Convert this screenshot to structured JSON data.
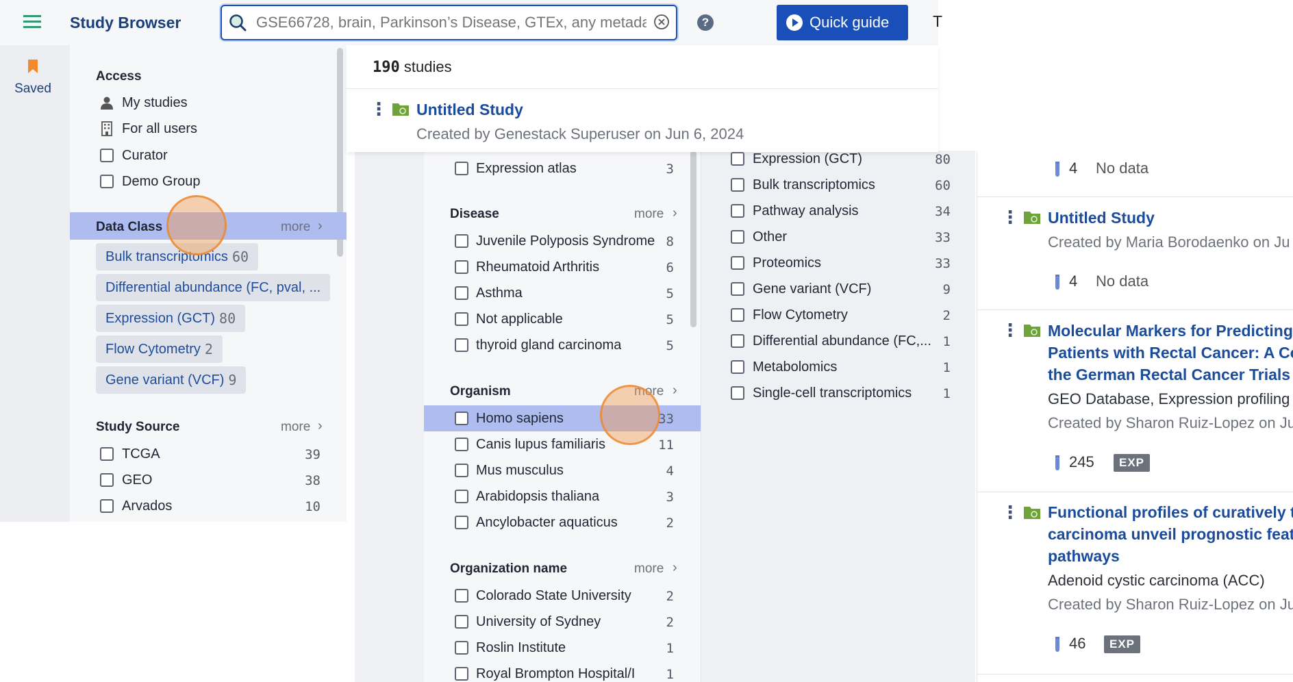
{
  "header": {
    "app_title": "Study Browser",
    "search_placeholder": "GSE66728, brain, Parkinson’s Disease, GTEx, any metadata",
    "quick_guide": "Quick guide",
    "cut_text": "T"
  },
  "rail": {
    "saved_label": "Saved"
  },
  "left_filters": {
    "access": {
      "title": "Access",
      "items": [
        "My studies",
        "For all users",
        "Curator",
        "Demo Group"
      ]
    },
    "data_class": {
      "title": "Data Class",
      "more": "more",
      "chips": [
        {
          "label": "Bulk transcriptomics",
          "count": "60"
        },
        {
          "label": "Differential abundance (FC, pval, ...",
          "count": ""
        },
        {
          "label": "Expression (GCT)",
          "count": "80"
        },
        {
          "label": "Flow Cytometry",
          "count": "2"
        },
        {
          "label": "Gene variant (VCF)",
          "count": "9"
        }
      ]
    },
    "study_source": {
      "title": "Study Source",
      "more": "more",
      "items": [
        {
          "label": "TCGA",
          "count": "39"
        },
        {
          "label": "GEO",
          "count": "38"
        },
        {
          "label": "Arvados",
          "count": "10"
        }
      ]
    }
  },
  "results": {
    "count": "190",
    "count_suffix": "studies",
    "top_study": {
      "title": "Untitled Study",
      "meta": "Created by Genestack Superuser on Jun 6, 2024"
    }
  },
  "mid_filters": {
    "expression_atlas": {
      "label": "Expression atlas",
      "count": "3"
    },
    "disease": {
      "title": "Disease",
      "more": "more",
      "items": [
        {
          "label": "Juvenile Polyposis Syndrome",
          "count": "8"
        },
        {
          "label": "Rheumatoid Arthritis",
          "count": "6"
        },
        {
          "label": "Asthma",
          "count": "5"
        },
        {
          "label": "Not applicable",
          "count": "5"
        },
        {
          "label": "thyroid gland carcinoma",
          "count": "5"
        }
      ]
    },
    "organism": {
      "title": "Organism",
      "more": "more",
      "items": [
        {
          "label": "Homo sapiens",
          "count": "33"
        },
        {
          "label": "Canis lupus familiaris",
          "count": "11"
        },
        {
          "label": "Mus musculus",
          "count": "4"
        },
        {
          "label": "Arabidopsis thaliana",
          "count": "3"
        },
        {
          "label": "Ancylobacter aquaticus",
          "count": "2"
        }
      ]
    },
    "organization": {
      "title": "Organization name",
      "more": "more",
      "items": [
        {
          "label": "Colorado State University",
          "count": "2"
        },
        {
          "label": "University of Sydney",
          "count": "2"
        },
        {
          "label": "Roslin Institute",
          "count": "1"
        },
        {
          "label": "Royal Brompton Hospital/I...",
          "count": "1"
        }
      ]
    }
  },
  "data_class_list": {
    "items": [
      {
        "label": "Expression (GCT)",
        "count": "80"
      },
      {
        "label": "Bulk transcriptomics",
        "count": "60"
      },
      {
        "label": "Pathway analysis",
        "count": "34"
      },
      {
        "label": "Other",
        "count": "33"
      },
      {
        "label": "Proteomics",
        "count": "33"
      },
      {
        "label": "Gene variant (VCF)",
        "count": "9"
      },
      {
        "label": "Flow Cytometry",
        "count": "2"
      },
      {
        "label": "Differential abundance (FC,...",
        "count": "1"
      },
      {
        "label": "Metabolomics",
        "count": "1"
      },
      {
        "label": "Single-cell transcriptomics",
        "count": "1"
      }
    ]
  },
  "study_cards": {
    "card0": {
      "samples": "4",
      "data": "No data"
    },
    "card1": {
      "title": "Untitled Study",
      "meta": "Created by Maria Borodaenko on Ju",
      "samples": "4",
      "data": "No data"
    },
    "card2": {
      "title_lines": [
        "Molecular Markers for Predicting Tr",
        "Patients with Rectal Cancer: A Com",
        "the German Rectal Cancer Trials"
      ],
      "sub": "GEO Database, Expression profiling",
      "meta": "Created by Sharon Ruiz-Lopez on Ju",
      "samples": "245",
      "badge": "EXP"
    },
    "card3": {
      "title_lines": [
        "Functional profiles of curatively tre",
        "carcinoma unveil prognostic feature",
        "pathways"
      ],
      "sub": "Adenoid cystic carcinoma (ACC)",
      "meta": "Created by Sharon Ruiz-Lopez on Ju",
      "samples": "46",
      "badge": "EXP"
    }
  },
  "colors": {
    "brand_blue": "#1a4fba",
    "title_blue": "#1b4c9b",
    "highlight": "#aebcef",
    "folder_green": "#6fa33a",
    "saved_orange": "#f08a2c"
  }
}
